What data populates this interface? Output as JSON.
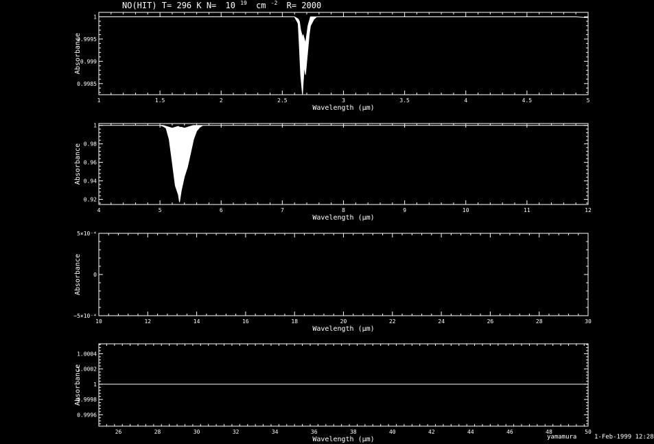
{
  "title": {
    "main": "NO(HIT) T= 296 K N=",
    "n_base": "10",
    "n_exp": "19",
    "n_unit": "cm",
    "n_unit_exp": "-2",
    "resolution": "R= 2000"
  },
  "footer": {
    "author": "yamamura",
    "date": "1-Feb-1999 12:28"
  },
  "colors": {
    "background": "#000000",
    "foreground": "#ffffff"
  },
  "chart_data": [
    {
      "type": "line",
      "xlabel": "Wavelength (μm)",
      "ylabel": "Absorbance",
      "xlim": [
        1,
        5
      ],
      "ylim": [
        0.99825,
        1.0001
      ],
      "x_ticks": [
        1,
        1.5,
        2,
        2.5,
        3,
        3.5,
        4,
        4.5,
        5
      ],
      "x_tick_labels": [
        "1",
        "1.5",
        "2",
        "2.5",
        "3",
        "3.5",
        "4",
        "4.5",
        "5"
      ],
      "y_ticks": [
        1,
        0.9995,
        0.999,
        0.9985
      ],
      "y_tick_labels": [
        "1",
        "0.9995",
        "0.999",
        "0.9985"
      ],
      "x": [
        1,
        2.6,
        2.63,
        2.64,
        2.65,
        2.66,
        2.665,
        2.67,
        2.68,
        2.69,
        2.7,
        2.71,
        2.72,
        2.73,
        2.74,
        2.76,
        2.78,
        2.8,
        4.9,
        5
      ],
      "y_lower": [
        1,
        1,
        0.99985,
        0.9993,
        0.9987,
        0.9984,
        0.99825,
        0.9985,
        0.9989,
        0.9987,
        0.999,
        0.9993,
        0.9996,
        0.9998,
        0.99985,
        0.99995,
        1,
        1,
        1,
        0.99998
      ],
      "y_upper": [
        1,
        1,
        0.99995,
        0.9999,
        0.9997,
        0.9996,
        0.9995,
        0.9996,
        0.9995,
        0.9994,
        0.9996,
        0.9998,
        0.9999,
        1,
        1,
        1,
        1,
        1,
        1,
        0.99998
      ]
    },
    {
      "type": "line",
      "xlabel": "Wavelength (μm)",
      "ylabel": "Absorbance",
      "xlim": [
        4,
        12
      ],
      "ylim": [
        0.9145,
        1.002
      ],
      "x_ticks": [
        4,
        5,
        6,
        7,
        8,
        9,
        10,
        11,
        12
      ],
      "x_tick_labels": [
        "4",
        "5",
        "6",
        "7",
        "8",
        "9",
        "10",
        "11",
        "12"
      ],
      "y_ticks": [
        1,
        0.98,
        0.96,
        0.94,
        0.92
      ],
      "y_tick_labels": [
        "1",
        "0.98",
        "0.96",
        "0.94",
        "0.92"
      ],
      "x": [
        4,
        5.0,
        5.05,
        5.1,
        5.15,
        5.2,
        5.25,
        5.3,
        5.32,
        5.35,
        5.4,
        5.45,
        5.5,
        5.55,
        5.6,
        5.65,
        5.7,
        12
      ],
      "y_lower": [
        1,
        1,
        0.999,
        0.997,
        0.985,
        0.96,
        0.935,
        0.925,
        0.917,
        0.93,
        0.945,
        0.955,
        0.97,
        0.985,
        0.994,
        0.998,
        1,
        1
      ],
      "y_upper": [
        1,
        1,
        1,
        0.999,
        0.998,
        0.997,
        0.998,
        0.999,
        0.998,
        0.998,
        0.997,
        0.998,
        0.999,
        1,
        1,
        1,
        1,
        1
      ]
    },
    {
      "type": "line",
      "xlabel": "Wavelength (μm)",
      "ylabel": "Absorbance",
      "xlim": [
        10,
        30
      ],
      "ylim": [
        -0.0005,
        0.0005
      ],
      "x_ticks": [
        10,
        12,
        14,
        16,
        18,
        20,
        22,
        24,
        26,
        28,
        30
      ],
      "x_tick_labels": [
        "10",
        "12",
        "14",
        "16",
        "18",
        "20",
        "22",
        "24",
        "26",
        "28",
        "30"
      ],
      "y_ticks": [
        0.0005,
        0,
        -0.0005
      ],
      "y_tick_labels": [
        "5×10⁻⁴",
        "0",
        "−5×10⁻⁴"
      ],
      "x": [],
      "y_lower": [],
      "y_upper": []
    },
    {
      "type": "line",
      "xlabel": "Wavelength (μm)",
      "ylabel": "Absorbance",
      "xlim": [
        25,
        50
      ],
      "ylim": [
        0.99945,
        1.00053
      ],
      "x_ticks": [
        26,
        28,
        30,
        32,
        34,
        36,
        38,
        40,
        42,
        44,
        46,
        48,
        50
      ],
      "x_tick_labels": [
        "26",
        "28",
        "30",
        "32",
        "34",
        "36",
        "38",
        "40",
        "42",
        "44",
        "46",
        "48",
        "50"
      ],
      "y_ticks": [
        1.0004,
        1.0002,
        1,
        0.9998,
        0.9996
      ],
      "y_tick_labels": [
        "1.0004",
        "1.0002",
        "1",
        "0.9998",
        "0.9996"
      ],
      "x": [
        25,
        50
      ],
      "y_lower": [
        1,
        1
      ],
      "y_upper": [
        1,
        1
      ]
    }
  ]
}
